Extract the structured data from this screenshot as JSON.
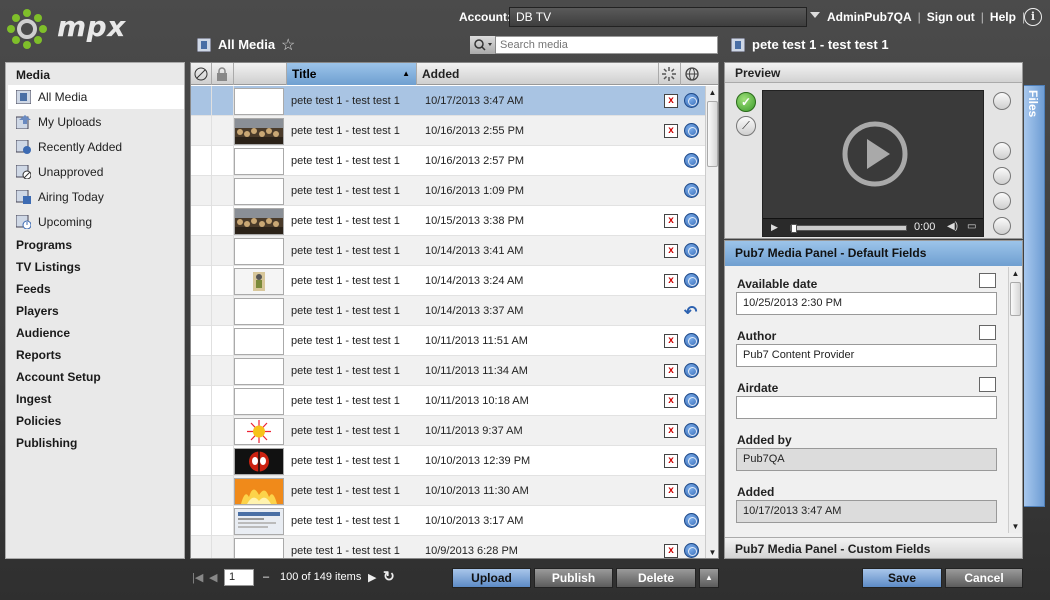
{
  "app": {
    "logo_text": "mpx"
  },
  "header": {
    "account_label": "Account:",
    "account_value": "DB TV",
    "user": "AdminPub7QA",
    "sign_out": "Sign out",
    "help": "Help",
    "info": "i"
  },
  "list_header": {
    "title": "All Media",
    "search_placeholder": "Search media"
  },
  "detail_header": {
    "title": "pete test 1 - test test 1"
  },
  "sidebar": {
    "media_label": "Media",
    "media_items": [
      {
        "label": "All Media",
        "icon": "film-icon"
      },
      {
        "label": "My Uploads",
        "icon": "upload-icon"
      },
      {
        "label": "Recently Added",
        "icon": "recent-icon"
      },
      {
        "label": "Unapproved",
        "icon": "unapproved-icon"
      },
      {
        "label": "Airing Today",
        "icon": "airing-icon"
      },
      {
        "label": "Upcoming",
        "icon": "upcoming-icon"
      }
    ],
    "sections": [
      "Programs",
      "TV Listings",
      "Feeds",
      "Players",
      "Audience",
      "Reports",
      "Account Setup",
      "Ingest",
      "Policies",
      "Publishing"
    ]
  },
  "grid": {
    "columns": {
      "title": "Title",
      "added": "Added"
    },
    "rows": [
      {
        "title": "pete test 1 - test test 1",
        "added": "10/17/2013 3:47 AM",
        "thumb": "blank",
        "status": "x",
        "action": "globe"
      },
      {
        "title": "pete test 1 - test test 1",
        "added": "10/16/2013 2:55 PM",
        "thumb": "crowd",
        "status": "x",
        "action": "globe"
      },
      {
        "title": "pete test 1 - test test 1",
        "added": "10/16/2013 2:57 PM",
        "thumb": "blank",
        "status": "",
        "action": "globe"
      },
      {
        "title": "pete test 1 - test test 1",
        "added": "10/16/2013 1:09 PM",
        "thumb": "blank",
        "status": "",
        "action": "globe"
      },
      {
        "title": "pete test 1 - test test 1",
        "added": "10/15/2013 3:38 PM",
        "thumb": "crowd",
        "status": "x",
        "action": "globe"
      },
      {
        "title": "pete test 1 - test test 1",
        "added": "10/14/2013 3:41 AM",
        "thumb": "blank",
        "status": "x",
        "action": "globe"
      },
      {
        "title": "pete test 1 - test test 1",
        "added": "10/14/2013 3:24 AM",
        "thumb": "figure",
        "status": "x",
        "action": "globe"
      },
      {
        "title": "pete test 1 - test test 1",
        "added": "10/14/2013 3:37 AM",
        "thumb": "blank",
        "status": "",
        "action": "reply"
      },
      {
        "title": "pete test 1 - test test 1",
        "added": "10/11/2013 11:51 AM",
        "thumb": "blank",
        "status": "x",
        "action": "globe"
      },
      {
        "title": "pete test 1 - test test 1",
        "added": "10/11/2013 11:34 AM",
        "thumb": "blank",
        "status": "x",
        "action": "globe"
      },
      {
        "title": "pete test 1 - test test 1",
        "added": "10/11/2013 10:18 AM",
        "thumb": "blank",
        "status": "x",
        "action": "globe"
      },
      {
        "title": "pete test 1 - test test 1",
        "added": "10/11/2013 9:37 AM",
        "thumb": "sun",
        "status": "x",
        "action": "globe"
      },
      {
        "title": "pete test 1 - test test 1",
        "added": "10/10/2013 12:39 PM",
        "thumb": "mask",
        "status": "x",
        "action": "globe"
      },
      {
        "title": "pete test 1 - test test 1",
        "added": "10/10/2013 11:30 AM",
        "thumb": "fire",
        "status": "x",
        "action": "globe"
      },
      {
        "title": "pete test 1 - test test 1",
        "added": "10/10/2013 3:17 AM",
        "thumb": "screen",
        "status": "",
        "action": "globe"
      },
      {
        "title": "pete test 1 - test test 1",
        "added": "10/9/2013 6:28 PM",
        "thumb": "blank",
        "status": "x",
        "action": "globe"
      }
    ]
  },
  "pager": {
    "page": "1",
    "dash": "–",
    "count_text": "100 of 149 items"
  },
  "actions": {
    "upload": "Upload",
    "publish": "Publish",
    "delete": "Delete"
  },
  "preview": {
    "title": "Preview",
    "time": "0:00"
  },
  "fields_panel": {
    "title": "Pub7 Media Panel - Default Fields",
    "fields": [
      {
        "label": "Available date",
        "value": "10/25/2013 2:30 PM"
      },
      {
        "label": "Author",
        "value": "Pub7 Content Provider"
      },
      {
        "label": "Airdate",
        "value": ""
      },
      {
        "label": "Added by",
        "value": "Pub7QA"
      },
      {
        "label": "Added",
        "value": "10/17/2013 3:47 AM"
      }
    ],
    "custom_title": "Pub7 Media Panel - Custom Fields"
  },
  "side_tab": {
    "label": "Files"
  },
  "footer": {
    "save": "Save",
    "cancel": "Cancel"
  },
  "colors": {
    "accent_blue": "#6f9fd0",
    "selection": "#a9c4e3",
    "chrome_dark": "#3c3c3c"
  }
}
